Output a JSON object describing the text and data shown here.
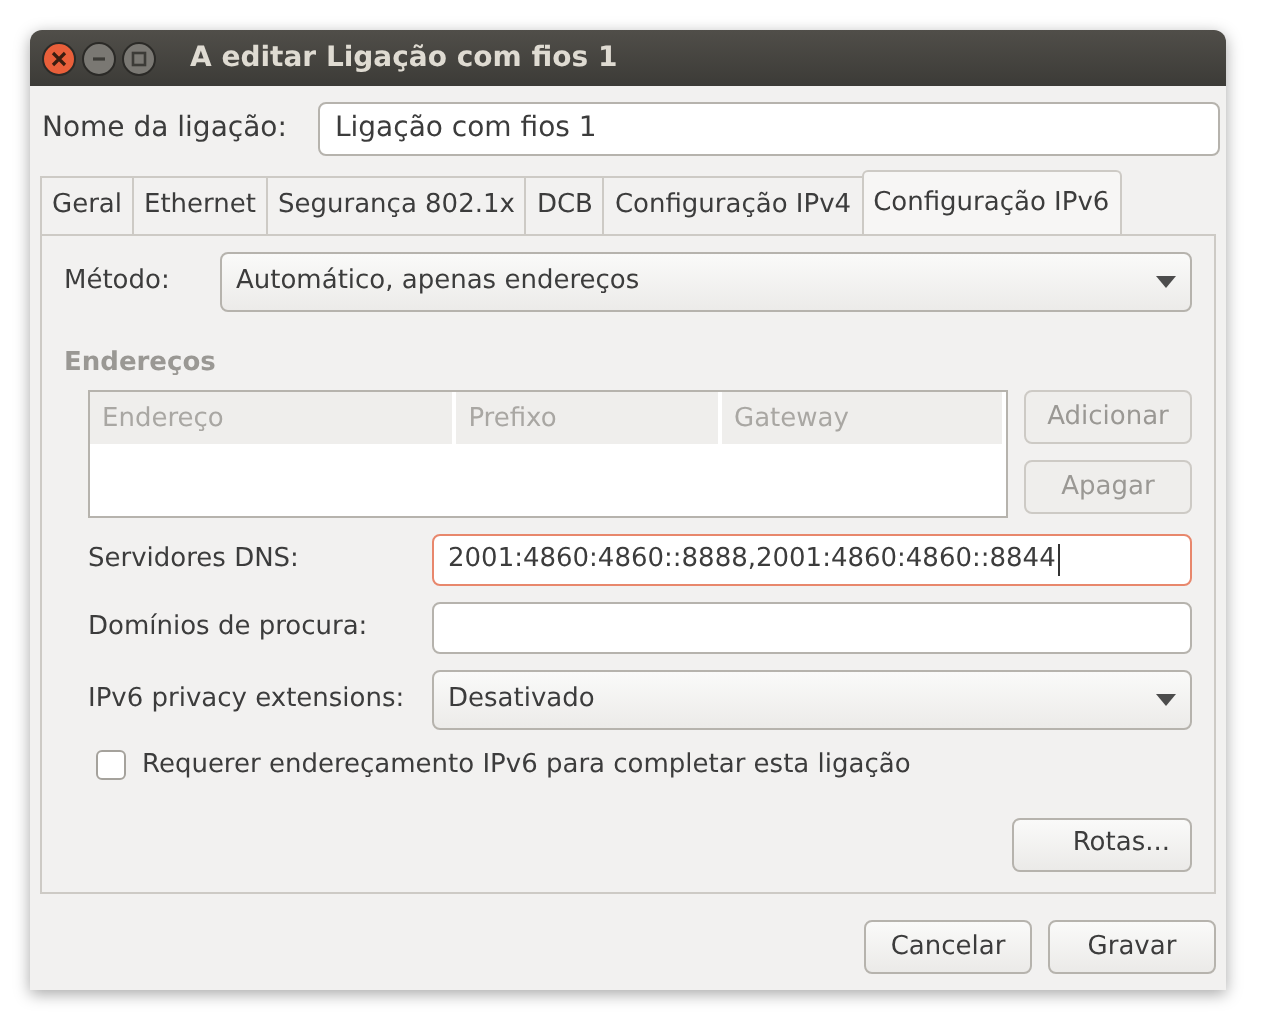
{
  "window": {
    "title": "A editar Ligação com fios 1"
  },
  "connection_name": {
    "label": "Nome da ligação:",
    "value": "Ligação com fios 1"
  },
  "tabs": [
    {
      "label": "Geral",
      "selected": false
    },
    {
      "label": "Ethernet",
      "selected": false
    },
    {
      "label": "Segurança 802.1x",
      "selected": false
    },
    {
      "label": "DCB",
      "selected": false
    },
    {
      "label": "Configuração IPv4",
      "selected": false
    },
    {
      "label": "Configuração IPv6",
      "selected": true
    }
  ],
  "method": {
    "label": "Método:",
    "value": "Automático, apenas endereços"
  },
  "addresses": {
    "heading": "Endereços",
    "disabled": true,
    "columns": [
      "Endereço",
      "Prefixo",
      "Gateway"
    ],
    "buttons": [
      {
        "label": "Adicionar",
        "disabled": true
      },
      {
        "label": "Apagar",
        "disabled": true
      }
    ]
  },
  "fields": [
    {
      "kind": "text",
      "label": "Servidores DNS:",
      "value": "2001:4860:4860::8888,2001:4860:4860::8844",
      "focused": true
    },
    {
      "kind": "text",
      "label": "Domínios de procura:",
      "focused": false
    },
    {
      "kind": "select",
      "label": "IPv6 privacy extensions:",
      "value": "Desativado",
      "focused": false
    }
  ],
  "require_ipv6": {
    "label": "Requerer endereçamento IPv6 para completar esta ligação",
    "checked": false
  },
  "routes_button": "Rotas...",
  "buttons": [
    "Cancelar",
    "Gravar"
  ]
}
